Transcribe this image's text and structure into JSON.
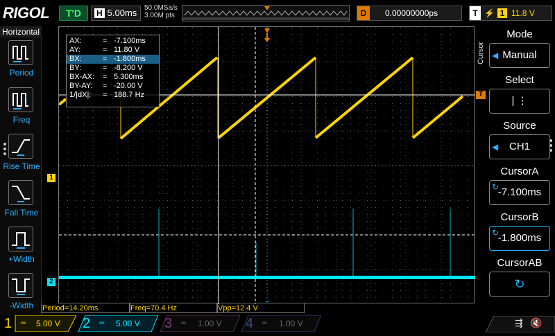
{
  "header": {
    "brand": "RIGOL",
    "run_status": "T'D",
    "timebase_label": "H",
    "timebase_value": "5.00ms",
    "sample_rate": "50.0MSa/s",
    "memory_depth": "3.00M pts",
    "delay_label": "D",
    "delay_value": "0.00000000ps",
    "trigger_label": "T",
    "trigger_source": "1",
    "trigger_level": "11.8 V"
  },
  "left_panel": {
    "title": "Horizontal",
    "items": [
      {
        "label": "Period",
        "icon": "period-icon"
      },
      {
        "label": "Freq",
        "icon": "frequency-icon"
      },
      {
        "label": "Rise Time",
        "icon": "rise-time-icon"
      },
      {
        "label": "Fall Time",
        "icon": "fall-time-icon"
      },
      {
        "label": "+Width",
        "icon": "positive-width-icon"
      },
      {
        "label": "-Width",
        "icon": "negative-width-icon"
      }
    ]
  },
  "cursor_readout": [
    {
      "key": "AX:",
      "eq": "=",
      "value": "-7.100ms"
    },
    {
      "key": "AY:",
      "eq": "=",
      "value": "11.80 V"
    },
    {
      "key": "BX:",
      "eq": "=",
      "value": "-1.800ms"
    },
    {
      "key": "BY:",
      "eq": "=",
      "value": "-8.200 V"
    },
    {
      "key": "BX-AX:",
      "eq": "=",
      "value": "5.300ms"
    },
    {
      "key": "BY-AY:",
      "eq": "=",
      "value": "-20.00 V"
    },
    {
      "key": "1/|dX|:",
      "eq": "=",
      "value": "188.7 Hz"
    }
  ],
  "right_panel": {
    "side_label": "Cursor",
    "items": [
      {
        "title": "Mode",
        "value": "Manual"
      },
      {
        "title": "Select",
        "value": "|   ⋮"
      },
      {
        "title": "Source",
        "value": "CH1"
      },
      {
        "title": "CursorA",
        "value": "-7.100ms"
      },
      {
        "title": "CursorB",
        "value": "-1.800ms"
      },
      {
        "title": "CursorAB",
        "value": ""
      }
    ]
  },
  "measurements": {
    "period": "Period=14.20ms",
    "freq": "Freq=70.4 Hz",
    "vpp": "Vpp=12.4 V"
  },
  "channels": [
    {
      "num": "1",
      "scale": "5.00 V",
      "color": "#ffd400",
      "active": true
    },
    {
      "num": "2",
      "scale": "5.00 V",
      "color": "#00e5ff",
      "active": true
    },
    {
      "num": "3",
      "scale": "1.00 V",
      "color": "#d040d0",
      "active": false
    },
    {
      "num": "4",
      "scale": "1.00 V",
      "color": "#3a6cff",
      "active": false
    }
  ],
  "markers": {
    "ch1": "1",
    "ch2": "2",
    "trigger_position": "T"
  },
  "colors": {
    "ch1": "#ffd400",
    "ch2": "#00e5ff",
    "accent": "#2ab0ff",
    "trigger_marker": "#e07a00"
  }
}
